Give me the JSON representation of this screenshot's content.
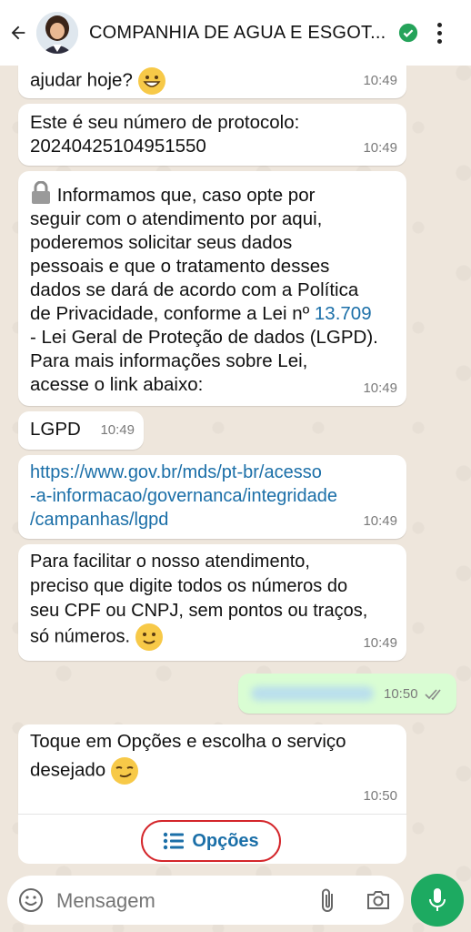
{
  "header": {
    "title": "COMPANHIA DE AGUA E ESGOT..."
  },
  "messages": [
    {
      "text": "ajudar hoje? ",
      "time": "10:49"
    },
    {
      "line1": "Este é seu número de protocolo:",
      "line2": "20240425104951550",
      "time": "10:49"
    },
    {
      "lines": [
        " Informamos que, caso opte por",
        "seguir com o atendimento por aqui,",
        "poderemos solicitar seus dados",
        "pessoais e que o tratamento desses",
        "dados se dará de acordo com a Política",
        "de Privacidade, conforme a Lei nº ",
        "- Lei Geral de Proteção de dados (LGPD).",
        "Para mais informações sobre  Lei,",
        "acesse o link abaixo:"
      ],
      "law_link": "13.709",
      "time": "10:49"
    },
    {
      "text": "LGPD",
      "time": "10:49"
    },
    {
      "link_lines": [
        "https://www.gov.br/mds/pt-br/acesso",
        "-a-informacao/governanca/integridade",
        "/campanhas/lgpd"
      ],
      "time": "10:49"
    },
    {
      "lines": [
        "Para facilitar o nosso atendimento,",
        "preciso que digite todos os números do",
        "seu CPF ou CNPJ, sem pontos ou traços,",
        "só números. "
      ],
      "time": "10:49"
    },
    {
      "outgoing": true,
      "time": "10:50"
    },
    {
      "line1": "Toque em Opções e escolha o serviço",
      "line2": "desejado ",
      "time": "10:50",
      "button_label": "Opções"
    }
  ],
  "composer": {
    "placeholder": "Mensagem"
  },
  "icons": {
    "back": "arrow-left-icon",
    "verified": "verified-badge-icon",
    "menu": "kebab-menu-icon",
    "emoji": "emoji-icon",
    "attach": "paperclip-icon",
    "camera": "camera-icon",
    "mic": "microphone-icon",
    "list": "list-icon",
    "lock": "lock-icon"
  },
  "colors": {
    "accent": "#1daa61",
    "link": "#1b6fa8",
    "outgoing_bubble": "#d9fdd3",
    "highlight": "#d4262b"
  }
}
